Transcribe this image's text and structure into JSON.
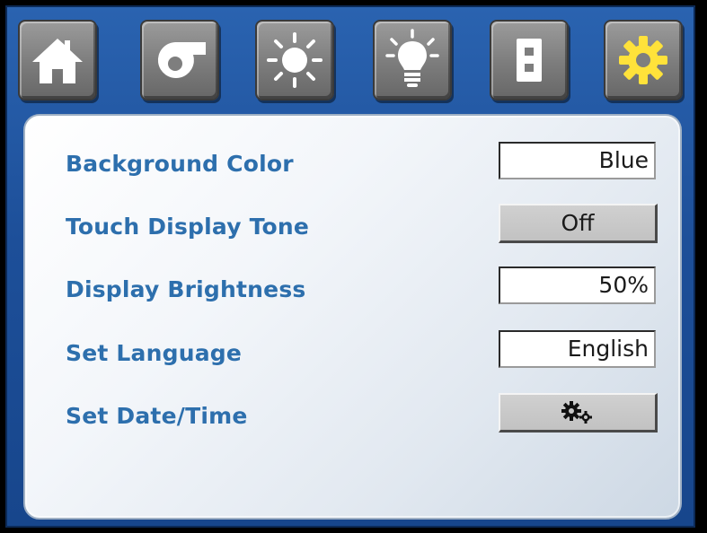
{
  "toolbar": {
    "tabs": [
      {
        "icon": "home-icon",
        "selected": false
      },
      {
        "icon": "blower-icon",
        "selected": false
      },
      {
        "icon": "sun-icon",
        "selected": false
      },
      {
        "icon": "lightbulb-icon",
        "selected": false
      },
      {
        "icon": "switch-icon",
        "selected": false
      },
      {
        "icon": "gear-icon",
        "selected": true,
        "icon_color": "#ffe23a"
      }
    ]
  },
  "settings": {
    "background_color": {
      "label": "Background Color",
      "value": "Blue"
    },
    "touch_display_tone": {
      "label": "Touch Display Tone",
      "value": "Off"
    },
    "display_brightness": {
      "label": "Display Brightness",
      "value": "50%"
    },
    "set_language": {
      "label": "Set Language",
      "value": "English"
    },
    "set_date_time": {
      "label": "Set Date/Time",
      "button_icon": "gears-icon"
    }
  },
  "colors": {
    "frame_blue": "#1d4f99",
    "label_blue": "#2d6fad",
    "selected_icon_yellow": "#ffe23a"
  }
}
